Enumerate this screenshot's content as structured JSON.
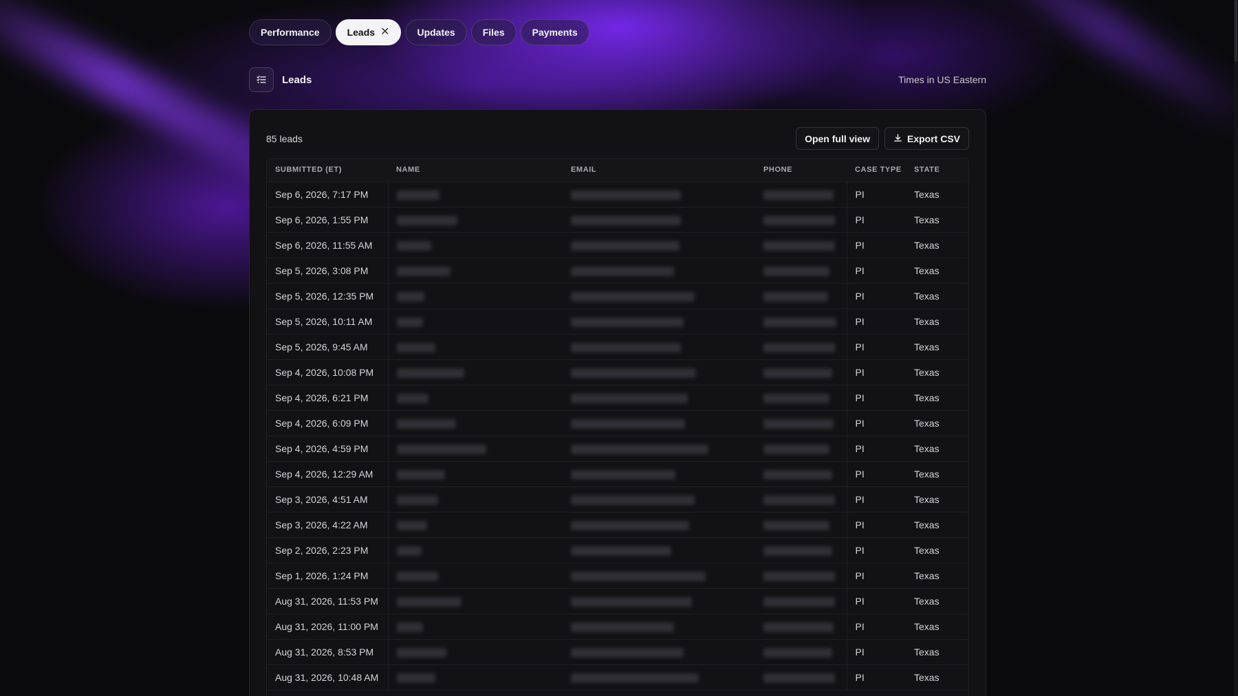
{
  "tabs": [
    {
      "label": "Performance",
      "active": false
    },
    {
      "label": "Leads",
      "active": true
    },
    {
      "label": "Updates",
      "active": false
    },
    {
      "label": "Files",
      "active": false
    },
    {
      "label": "Payments",
      "active": false
    }
  ],
  "header": {
    "title": "Leads",
    "timezone_note": "Times in US Eastern"
  },
  "card": {
    "count_label": "85 leads",
    "open_full_view_label": "Open full view",
    "export_csv_label": "Export CSV"
  },
  "table": {
    "columns": [
      "SUBMITTED (ET)",
      "NAME",
      "EMAIL",
      "PHONE",
      "CASE TYPE",
      "STATE"
    ],
    "rows": [
      {
        "submitted": "Sep 6, 2026, 7:17 PM",
        "case_type": "PI",
        "state": "Texas"
      },
      {
        "submitted": "Sep 6, 2026, 1:55 PM",
        "case_type": "PI",
        "state": "Texas"
      },
      {
        "submitted": "Sep 6, 2026, 11:55 AM",
        "case_type": "PI",
        "state": "Texas"
      },
      {
        "submitted": "Sep 5, 2026, 3:08 PM",
        "case_type": "PI",
        "state": "Texas"
      },
      {
        "submitted": "Sep 5, 2026, 12:35 PM",
        "case_type": "PI",
        "state": "Texas"
      },
      {
        "submitted": "Sep 5, 2026, 10:11 AM",
        "case_type": "PI",
        "state": "Texas"
      },
      {
        "submitted": "Sep 5, 2026, 9:45 AM",
        "case_type": "PI",
        "state": "Texas"
      },
      {
        "submitted": "Sep 4, 2026, 10:08 PM",
        "case_type": "PI",
        "state": "Texas"
      },
      {
        "submitted": "Sep 4, 2026, 6:21 PM",
        "case_type": "PI",
        "state": "Texas"
      },
      {
        "submitted": "Sep 4, 2026, 6:09 PM",
        "case_type": "PI",
        "state": "Texas"
      },
      {
        "submitted": "Sep 4, 2026, 4:59 PM",
        "case_type": "PI",
        "state": "Texas"
      },
      {
        "submitted": "Sep 4, 2026, 12:29 AM",
        "case_type": "PI",
        "state": "Texas"
      },
      {
        "submitted": "Sep 3, 2026, 4:51 AM",
        "case_type": "PI",
        "state": "Texas"
      },
      {
        "submitted": "Sep 3, 2026, 4:22 AM",
        "case_type": "PI",
        "state": "Texas"
      },
      {
        "submitted": "Sep 2, 2026, 2:23 PM",
        "case_type": "PI",
        "state": "Texas"
      },
      {
        "submitted": "Sep 1, 2026, 1:24 PM",
        "case_type": "PI",
        "state": "Texas"
      },
      {
        "submitted": "Aug 31, 2026, 11:53 PM",
        "case_type": "PI",
        "state": "Texas"
      },
      {
        "submitted": "Aug 31, 2026, 11:00 PM",
        "case_type": "PI",
        "state": "Texas"
      },
      {
        "submitted": "Aug 31, 2026, 8:53 PM",
        "case_type": "PI",
        "state": "Texas"
      },
      {
        "submitted": "Aug 31, 2026, 10:48 AM",
        "case_type": "PI",
        "state": "Texas"
      }
    ]
  },
  "icons": {
    "leads_section": "list-filter-icon",
    "close_tab": "close-icon",
    "export": "download-icon"
  },
  "colors": {
    "accent_purple": "#7a2cf0",
    "background": "#0a0a0c",
    "card": "#121214"
  }
}
